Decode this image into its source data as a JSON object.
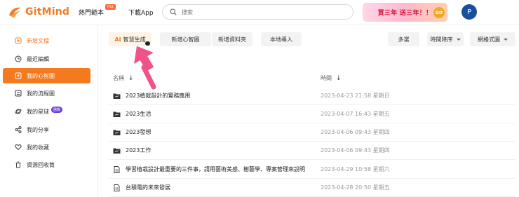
{
  "app": {
    "name": "GitMind"
  },
  "nav": {
    "templates": "熱門範本",
    "hot": "Hot",
    "download": "下載App"
  },
  "search": {
    "placeholder": "搜索"
  },
  "promo": {
    "text": "買三年 送三年！！",
    "go": "GO"
  },
  "user": {
    "avatar_letter": "P"
  },
  "sidebar": {
    "items": [
      {
        "label": "新增文檔",
        "icon": "add-doc-icon"
      },
      {
        "label": "最近編輯",
        "icon": "clock-icon"
      },
      {
        "label": "我的心智圖",
        "icon": "mindmap-icon"
      },
      {
        "label": "我的流程圖",
        "icon": "flowchart-icon"
      },
      {
        "label": "我的星球",
        "icon": "planet-icon",
        "badge": "團隊"
      },
      {
        "label": "我的分享",
        "icon": "share-icon"
      },
      {
        "label": "我的收藏",
        "icon": "heart-icon"
      },
      {
        "label": "資源回收筒",
        "icon": "trash-icon"
      }
    ]
  },
  "toolbar": {
    "ai_prefix": "AI",
    "ai_label": "智慧生成",
    "new_map": "新增心智圖",
    "new_folder": "新增資料夾",
    "local_import": "本地導入",
    "multi_select": "多選",
    "sort": "時間降序",
    "view": "網格式圖"
  },
  "table": {
    "col_name": "名稱",
    "col_time": "時間",
    "rows": [
      {
        "type": "folder",
        "name": "2023植栽設計的實務應用",
        "time": "2023-04-23 21:58 星期日"
      },
      {
        "type": "folder",
        "name": "2023生活",
        "time": "2023-04-07 16:43 星期五"
      },
      {
        "type": "folder",
        "name": "2023發想",
        "time": "2023-04-06 09:43 星期四"
      },
      {
        "type": "folder",
        "name": "2023工作",
        "time": "2023-04-06 09:43 星期四"
      },
      {
        "type": "file",
        "name": "學習植栽設計最重要的三件事，請用藝術美感、樹藝學、專案管理來說明",
        "time": "2023-04-29 10:58 星期六"
      },
      {
        "type": "file",
        "name": "台積電的未來發展",
        "time": "2023-04-28 20:50 星期五"
      }
    ]
  },
  "colors": {
    "accent": "#f47a20",
    "badge_purple": "#6b3fd8",
    "arrow": "#f0528a"
  }
}
